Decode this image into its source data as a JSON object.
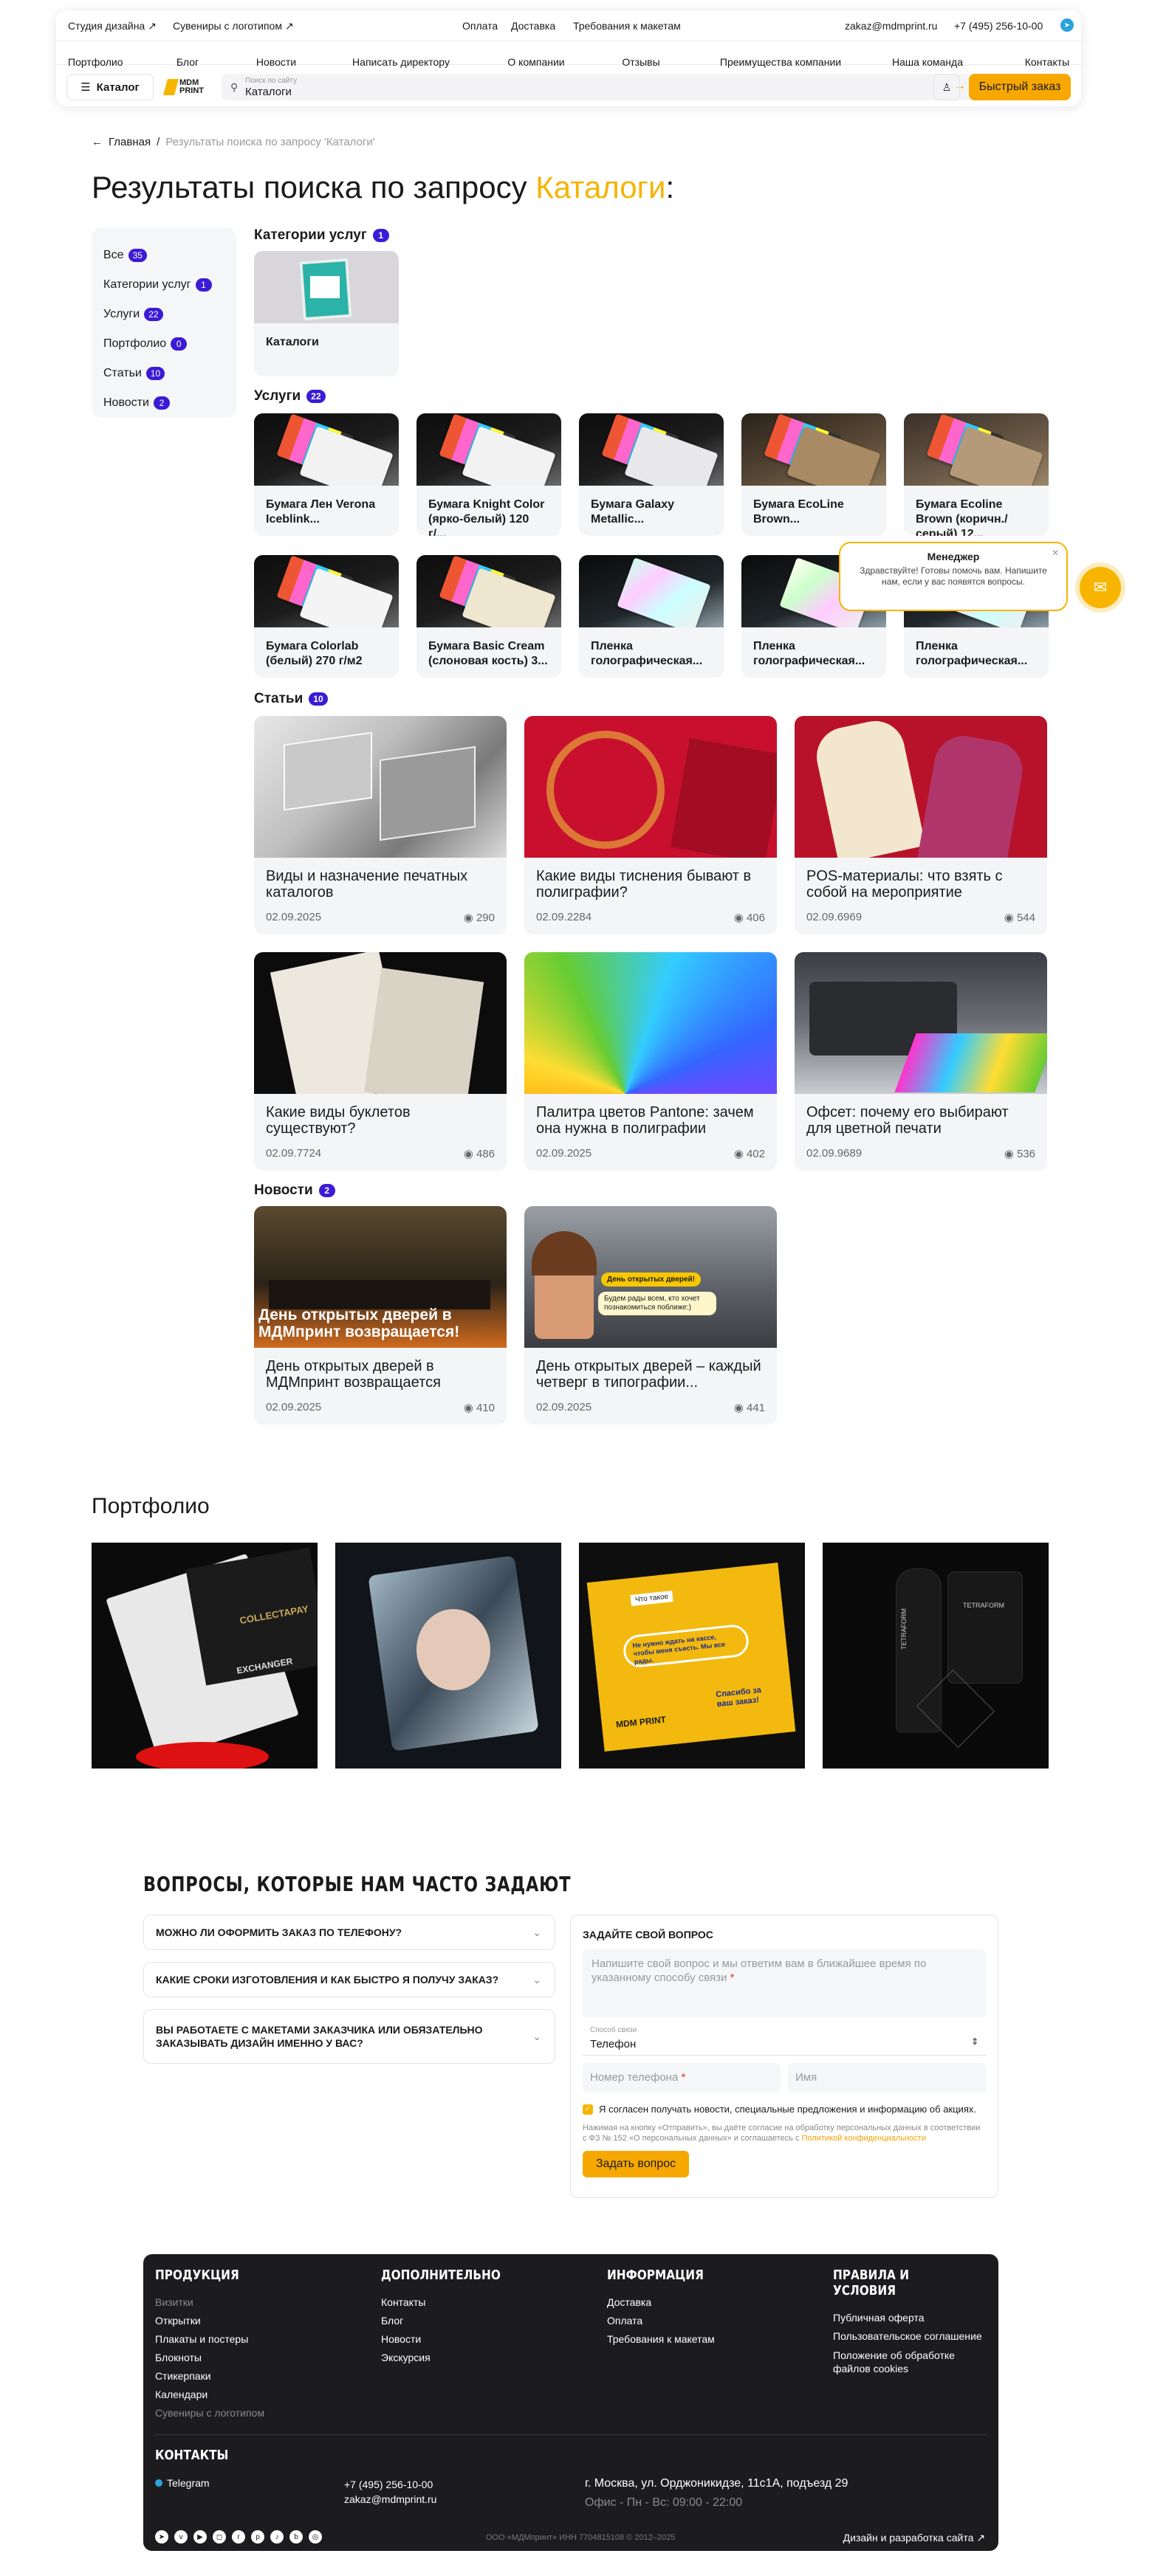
{
  "header": {
    "top_left": [
      "Студия дизайна ↗",
      "Сувениры с логотипом ↗"
    ],
    "top_center": [
      "Оплата",
      "Доставка",
      "Требования к макетам"
    ],
    "email": "zakaz@mdmprint.ru",
    "phone": "+7 (495) 256-10-00",
    "nav": [
      "Портфолио",
      "Блог",
      "Новости",
      "Написать директору",
      "О компании",
      "Отзывы",
      "Преимущества компании",
      "Наша команда",
      "Контакты"
    ],
    "catalog_label": "Каталог",
    "logo_text": "MDM PRINT",
    "search_placeholder": "Поиск по сайту",
    "search_value": "Каталоги",
    "quick_order": "Быстрый заказ"
  },
  "breadcrumb": {
    "home": "Главная",
    "current": "Результаты поиска по запросу 'Каталоги'"
  },
  "title": {
    "prefix": "Результаты поиска по запросу",
    "query": "Каталоги",
    "suffix": ":"
  },
  "filters": [
    {
      "label": "Все",
      "count": "35"
    },
    {
      "label": "Категории услуг",
      "count": "1"
    },
    {
      "label": "Услуги",
      "count": "22"
    },
    {
      "label": "Портфолио",
      "count": "0"
    },
    {
      "label": "Статьи",
      "count": "10"
    },
    {
      "label": "Новости",
      "count": "2"
    }
  ],
  "categories": {
    "heading": "Категории услуг",
    "count": "1",
    "items": [
      {
        "title": "Каталоги"
      }
    ]
  },
  "services": {
    "heading": "Услуги",
    "count": "22",
    "items": [
      {
        "title": "Бумага Лен Verona Iceblink..."
      },
      {
        "title": "Бумага Knight Color (ярко-белый) 120 г/..."
      },
      {
        "title": "Бумага Galaxy Metallic..."
      },
      {
        "title": "Бумага EcoLine Brown..."
      },
      {
        "title": "Бумага Ecoline Brown (коричн./серый) 12..."
      },
      {
        "title": "Бумага Colorlab (белый) 270 г/м2"
      },
      {
        "title": "Бумага Basic Cream (слоновая кость) 3..."
      },
      {
        "title": "Пленка голографическая..."
      },
      {
        "title": "Пленка голографическая..."
      },
      {
        "title": "Пленка голографическая..."
      }
    ]
  },
  "articles": {
    "heading": "Статьи",
    "count": "10",
    "items": [
      {
        "title": "Виды и назначение печатных каталогов",
        "date": "02.09.2025",
        "views": "290"
      },
      {
        "title": "Какие виды тиснения бывают в полиграфии?",
        "date": "02.09.2284",
        "views": "406"
      },
      {
        "title": "POS-материалы: что взять с собой на мероприятие",
        "date": "02.09.6969",
        "views": "544"
      },
      {
        "title": "Какие виды буклетов существуют?",
        "date": "02.09.7724",
        "views": "486"
      },
      {
        "title": "Палитра цветов Pantone: зачем она нужна в полиграфии",
        "date": "02.09.2025",
        "views": "402"
      },
      {
        "title": "Офсет: почему его выбирают для цветной печати",
        "date": "02.09.9689",
        "views": "536"
      }
    ]
  },
  "news": {
    "heading": "Новости",
    "count": "2",
    "items": [
      {
        "title": "День открытых дверей в МДМпринт возвращается",
        "date": "02.09.2025",
        "views": "410",
        "overlay": "День открытых дверей в МДМпринт возвращается!"
      },
      {
        "title": "День открытых дверей – каждый четверг в типографии...",
        "date": "02.09.2025",
        "views": "441",
        "bubble1": "День открытых дверей!",
        "bubble2": "Будем рады всем, кто хочет познакомиться поближе:)"
      }
    ]
  },
  "manager": {
    "name": "Менеджер",
    "text": "Здравствуйте! Готовы помочь вам. Напишите нам, если у вас появятся вопросы."
  },
  "portfolio": {
    "title": "Портфолио",
    "p1": [
      "COLLECTAPAY",
      "EXCHANGER"
    ],
    "p3": [
      "Что такое",
      "Не нужно ждать на кассе, чтобы меня съесть. Мы все рады.",
      "Спасибо за ваш заказ!",
      "MDM PRINT"
    ],
    "p4": [
      "TETRAFORM",
      "TETRAFORM"
    ]
  },
  "faq": {
    "title": "ВОПРОСЫ, КОТОРЫЕ НАМ ЧАСТО ЗАДАЮТ",
    "items": [
      "Можно ли оформить заказ по телефону?",
      "Какие сроки изготовления и как быстро я получу заказ?",
      "Вы работаете с макетами заказчика или обязательно заказывать дизайн именно у вас?"
    ],
    "form": {
      "heading": "ЗАДАЙТЕ СВОЙ ВОПРОС",
      "question_placeholder": "Напишите свой вопрос и мы ответим вам в ближайшее время по указанному способу связи",
      "contact_label": "Способ связи",
      "contact_value": "Телефон",
      "phone_placeholder": "Номер телефона",
      "name_placeholder": "Имя",
      "consent": "Я согласен получать новости, специальные предложения и информацию об акциях.",
      "legal": "Нажимая на кнопку «Отправить», вы даёте согласие на обработку персональных данных в соответствии с ФЗ № 152 «О персональных данных» и соглашаетесь с",
      "legal_link": "Политикой конфиденциальности",
      "submit": "Задать вопрос"
    }
  },
  "footer": {
    "col1": {
      "heading": "ПРОДУКЦИЯ",
      "items": [
        "Визитки",
        "Открытки",
        "Плакаты и постеры",
        "Блокноты",
        "Стикерпаки",
        "Календари",
        "Сувениры с логотипом"
      ]
    },
    "col2": {
      "heading": "ДОПОЛНИТЕЛЬНО",
      "items": [
        "Контакты",
        "Блог",
        "Новости",
        "Экскурсия"
      ]
    },
    "col3": {
      "heading": "ИНФОРМАЦИЯ",
      "items": [
        "Доставка",
        "Оплата",
        "Требования к макетам"
      ]
    },
    "col4": {
      "heading": "ПРАВИЛА И УСЛОВИЯ",
      "items": [
        "Публичная оферта",
        "Пользовательское соглашение",
        "Положение об обработке файлов cookies"
      ]
    },
    "contacts_heading": "КОНТАКТЫ",
    "telegram": "Telegram",
    "phone": "+7 (495) 256-10-00",
    "email": "zakaz@mdmprint.ru",
    "address": "г. Москва, ул. Орджоникидзе, 11с1А, подъезд 29",
    "hours": "Офис - Пн - Вс: 09:00 - 22:00",
    "copyright": "ООО «МДМпринт»   ИНН 7704815108   © 2012–2025",
    "dev": "Дизайн и разработка сайта ↗"
  }
}
